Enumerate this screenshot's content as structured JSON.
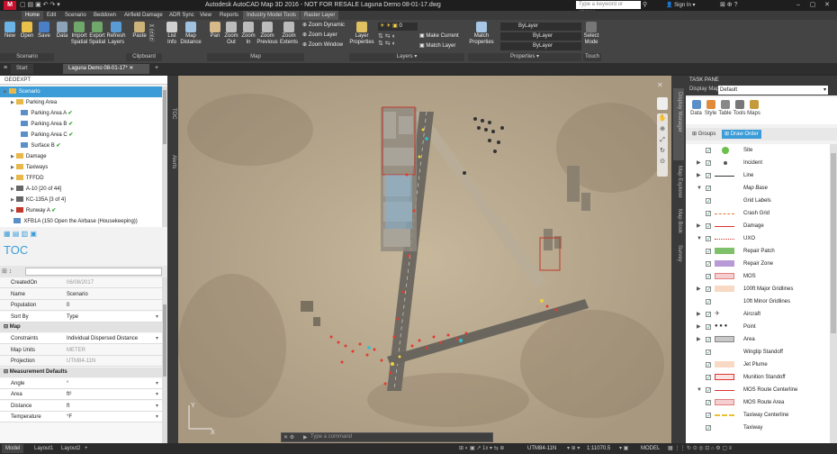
{
  "app": {
    "title": "Autodesk AutoCAD Map 3D 2016 - NOT FOR RESALE   Laguna Demo 08-01-17.dwg",
    "logo": "M",
    "search_placeholder": "Type a keyword or phrase",
    "signin": "Sign In"
  },
  "ribbon_tabs": [
    "Home",
    "Edit",
    "Scenario",
    "Beddown",
    "Airfield Damage",
    "ADR Sync",
    "View",
    "Reports",
    "Industry Model Tools",
    "Raster Layer"
  ],
  "ribbon": {
    "buttons": {
      "new": "New",
      "open": "Open",
      "save": "Save",
      "data": "Data",
      "import": "Import Spatial",
      "export": "Export Spatial",
      "refresh": "Refresh Layers",
      "paste": "Paste",
      "list_info": "List Info",
      "map_distance": "Map Distance",
      "pan": "Pan",
      "zoom_out": "Zoom Out",
      "zoom_in": "Zoom In",
      "zoom_previous": "Zoom Previous",
      "zoom_extents": "Zoom Extents",
      "layer_properties": "Layer Properties",
      "match_properties": "Match Properties",
      "select_mode": "Select Mode"
    },
    "small": {
      "zoom_dynamic": "Zoom Dynamic",
      "zoom_layer": "Zoom Layer",
      "zoom_window": "Zoom Window",
      "make_current": "Make Current",
      "match_layer": "Match Layer",
      "layer_value": "0",
      "bylayer1": "ByLayer",
      "bylayer2": "ByLayer",
      "bylayer3": "ByLayer"
    },
    "panels": {
      "scenario": "Scenario",
      "clipboard": "Clipboard",
      "map": "Map",
      "layers": "Layers ▾",
      "properties": "Properties ▾",
      "touch": "Touch"
    }
  },
  "doc_tabs": {
    "start": "Start",
    "active": "Laguna Demo 08-01-17*"
  },
  "geoexpt": {
    "header": "GEOEXPT",
    "tree": [
      {
        "label": "Scenario",
        "level": 0,
        "type": "root",
        "selected": true
      },
      {
        "label": "Parking Area",
        "level": 1,
        "type": "folder"
      },
      {
        "label": "Parking Area A",
        "level": 2,
        "type": "item",
        "check": true
      },
      {
        "label": "Parking Area B",
        "level": 2,
        "type": "item",
        "check": true
      },
      {
        "label": "Parking Area C",
        "level": 2,
        "type": "item",
        "check": true
      },
      {
        "label": "Surface B",
        "level": 2,
        "type": "item",
        "check": true
      },
      {
        "label": "Damage",
        "level": 1,
        "type": "folder"
      },
      {
        "label": "Taxiways",
        "level": 1,
        "type": "folder"
      },
      {
        "label": "TFFDD",
        "level": 1,
        "type": "folder"
      },
      {
        "label": "A-10 [20 of 44]",
        "level": 1,
        "type": "plane"
      },
      {
        "label": "KC-135A [3 of 4]",
        "level": 1,
        "type": "plane"
      },
      {
        "label": "Runway A",
        "level": 1,
        "type": "runway",
        "check": true
      },
      {
        "label": "XFB1A (150 Open the Airbase (Housekeeping))",
        "level": 1,
        "type": "item"
      }
    ],
    "toc_label": "TOC"
  },
  "properties": {
    "rows": [
      {
        "k": "CreatedOn",
        "v": "06/08/2017",
        "dim": true
      },
      {
        "k": "Name",
        "v": "Scenario"
      },
      {
        "k": "Population",
        "v": "0"
      },
      {
        "k": "Sort By",
        "v": "Type",
        "dd": true
      }
    ],
    "map_section": "Map",
    "map_rows": [
      {
        "k": "Constraints",
        "v": "Individual Dispersed Distance",
        "dd": true
      },
      {
        "k": "Map Units",
        "v": "METER",
        "dim": true
      },
      {
        "k": "Projection",
        "v": "UTM84-11N",
        "dim": true
      }
    ],
    "measure_section": "Measurement Defaults",
    "measure_rows": [
      {
        "k": "Angle",
        "v": "°",
        "dd": true
      },
      {
        "k": "Area",
        "v": "ft²",
        "dd": true
      },
      {
        "k": "Distance",
        "v": "ft",
        "dd": true
      },
      {
        "k": "Temperature",
        "v": "°F",
        "dd": true
      }
    ]
  },
  "side_labels": {
    "toc": "TOC",
    "alerts": "Alerts",
    "display_manager": "Display Manager",
    "map_explorer": "Map Explorer",
    "map_book": "Map Book",
    "survey": "Survey"
  },
  "taskpane": {
    "header": "TASK PANE",
    "display_map_label": "Display Map:",
    "display_map_value": "Default",
    "tools": [
      "Data",
      "Style",
      "Table",
      "Tools",
      "Maps"
    ],
    "groups": "Groups",
    "draw_order": "Draw Order",
    "layers": [
      {
        "name": "Site",
        "exp": false,
        "sym": "green-circle"
      },
      {
        "name": "Incident",
        "exp": true,
        "sym": "dot"
      },
      {
        "name": "Line",
        "exp": true,
        "sym": "line"
      },
      {
        "name": "Map Base",
        "exp": "open",
        "sym": "none",
        "italic": true
      },
      {
        "name": "Grid Labels",
        "exp": false,
        "sym": "none"
      },
      {
        "name": "Crash Grid",
        "exp": false,
        "sym": "dashline"
      },
      {
        "name": "Damage",
        "exp": true,
        "sym": "redline"
      },
      {
        "name": "UXO",
        "exp": "open",
        "sym": "uxo"
      },
      {
        "name": "Repair Patch",
        "exp": false,
        "sym": "green-fill"
      },
      {
        "name": "Repair Zone",
        "exp": false,
        "sym": "purple-fill"
      },
      {
        "name": "MOS",
        "exp": false,
        "sym": "pink-fill"
      },
      {
        "name": "100ft Major Gridlines",
        "exp": true,
        "sym": "peach-fill"
      },
      {
        "name": "10ft Minor Gridlines",
        "exp": false,
        "sym": "none"
      },
      {
        "name": "Aircraft",
        "exp": true,
        "sym": "plane"
      },
      {
        "name": "Point",
        "exp": true,
        "sym": "dots"
      },
      {
        "name": "Area",
        "exp": true,
        "sym": "area"
      },
      {
        "name": "Wingtip Standoff",
        "exp": false,
        "sym": "none"
      },
      {
        "name": "Jet Plume",
        "exp": false,
        "sym": "peach-fill"
      },
      {
        "name": "Munition Standoff",
        "exp": false,
        "sym": "red-outline"
      },
      {
        "name": "MOS Route Centerline",
        "exp": "open",
        "sym": "redline"
      },
      {
        "name": "MOS Route Area",
        "exp": false,
        "sym": "pink-fill"
      },
      {
        "name": "Taxiway Centerline",
        "exp": false,
        "sym": "yellow-dash"
      },
      {
        "name": "Taxiway",
        "exp": false,
        "sym": "none"
      }
    ]
  },
  "command": {
    "placeholder": "Type a command"
  },
  "statusbar": {
    "layouts": [
      "Model",
      "Layout1",
      "Layout2"
    ],
    "coords": "UTM84-11N",
    "scale": "1:11070.5",
    "model": "MODEL"
  },
  "colors": {
    "accent": "#3b9cd8",
    "check": "#2aa12a",
    "ribbon_bg": "#444444",
    "panel_bg": "#f2f2f2"
  }
}
